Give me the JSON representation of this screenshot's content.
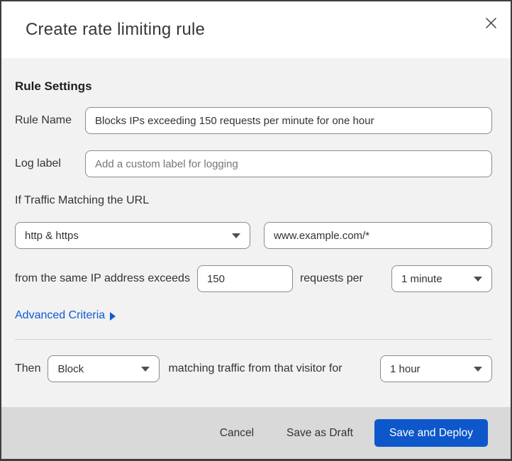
{
  "dialog": {
    "title": "Create rate limiting rule"
  },
  "icons": {
    "close": "x-close-icon",
    "select_caret": "triangle-down",
    "advanced_arrow": "triangle-right"
  },
  "rule_settings": {
    "heading": "Rule Settings",
    "rule_name": {
      "label": "Rule Name",
      "value": "Blocks IPs exceeding 150 requests per minute for one hour"
    },
    "log_label": {
      "label": "Log label",
      "placeholder": "Add a custom label for logging"
    }
  },
  "traffic_match": {
    "heading": "If Traffic Matching the URL",
    "scheme_select": {
      "value": "http & https"
    },
    "url_input": {
      "value": "www.example.com/*"
    },
    "threshold": {
      "prefix": "from the same IP address exceeds",
      "requests_value": "150",
      "infix": "requests per",
      "period_select": {
        "value": "1 minute"
      }
    },
    "advanced_criteria_label": "Advanced Criteria"
  },
  "then_clause": {
    "label": "Then",
    "action_select": {
      "value": "Block"
    },
    "infix": "matching traffic from that visitor for",
    "duration_select": {
      "value": "1 hour"
    }
  },
  "footer": {
    "cancel_label": "Cancel",
    "save_draft_label": "Save as Draft",
    "save_deploy_label": "Save and Deploy"
  },
  "colors": {
    "primary_button_blue": "#0d57cb",
    "link_blue": "#0b5cd5",
    "body_background": "#f2f2f2",
    "footer_background": "#d9d9d9"
  }
}
